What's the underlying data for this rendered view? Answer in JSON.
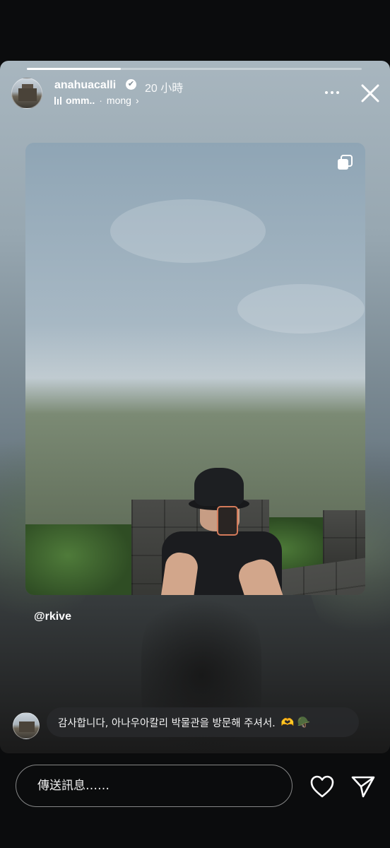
{
  "story": {
    "progress": 0.28,
    "header": {
      "username": "anahuacalli",
      "verified_mark": "✔",
      "time": "20 小時",
      "music_track": "omm..",
      "music_separator": "·",
      "music_artist": "mong",
      "music_chevron": "›"
    },
    "mention": "@rkive",
    "reply": {
      "text": "감사합니다, 아나우아칼리 박물관을 방문해 주셔서.",
      "emoji": "🫶 🪖"
    }
  },
  "footer": {
    "message_placeholder": "傳送訊息……"
  },
  "icons": {
    "avatar": "museum-avatar",
    "verified": "verified-badge-icon",
    "music": "music-bars-icon",
    "more": "more-dots-icon",
    "close": "close-icon",
    "multi": "multiple-photos-icon",
    "like": "heart-icon",
    "send": "send-icon"
  },
  "colors": {
    "background": "#0b0c0d",
    "text": "#ffffff"
  }
}
